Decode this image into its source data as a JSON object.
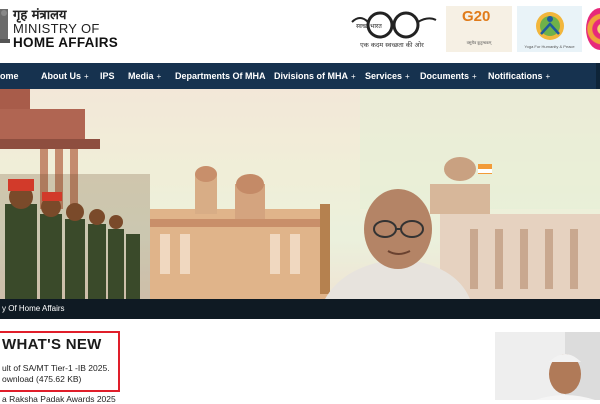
{
  "header": {
    "ministry_hindi": "गृह मंत्रालय",
    "ministry_line1": "MINISTRY OF",
    "ministry_line2": "HOME AFFAIRS",
    "swachh_label": "स्वच्छ भारत",
    "swachh_tagline": "एक कदम स्वच्छता की ओर",
    "g20_text": "G20",
    "g20_tagline": "वसुधैव कुटुम्बकम्",
    "yoga_tagline": "Yoga For Humanity & Peace"
  },
  "nav": {
    "items": [
      {
        "label": "ome",
        "has_submenu": false
      },
      {
        "label": "About Us",
        "has_submenu": true
      },
      {
        "label": "IPS",
        "has_submenu": false
      },
      {
        "label": "Media",
        "has_submenu": true
      },
      {
        "label": "Departments Of MHA",
        "has_submenu": false
      },
      {
        "label": "Divisions of MHA",
        "has_submenu": true
      },
      {
        "label": "Services",
        "has_submenu": true
      },
      {
        "label": "Documents",
        "has_submenu": true
      },
      {
        "label": "Notifications",
        "has_submenu": true
      }
    ],
    "plus_symbol": "+"
  },
  "banner": {
    "caption": "y Of Home Affairs"
  },
  "whats_new": {
    "title": "WHAT'S NEW",
    "item1_line1": "ult of SA/MT Tier-1 -IB 2025.",
    "item1_line2": "ownload (475.62 KB)",
    "item2_partial": "a Raksha Padak Awards 2025"
  },
  "colors": {
    "nav_bg": "#16324f",
    "highlight_border": "#e01e2a",
    "caption_bg": "#0f1a23"
  }
}
